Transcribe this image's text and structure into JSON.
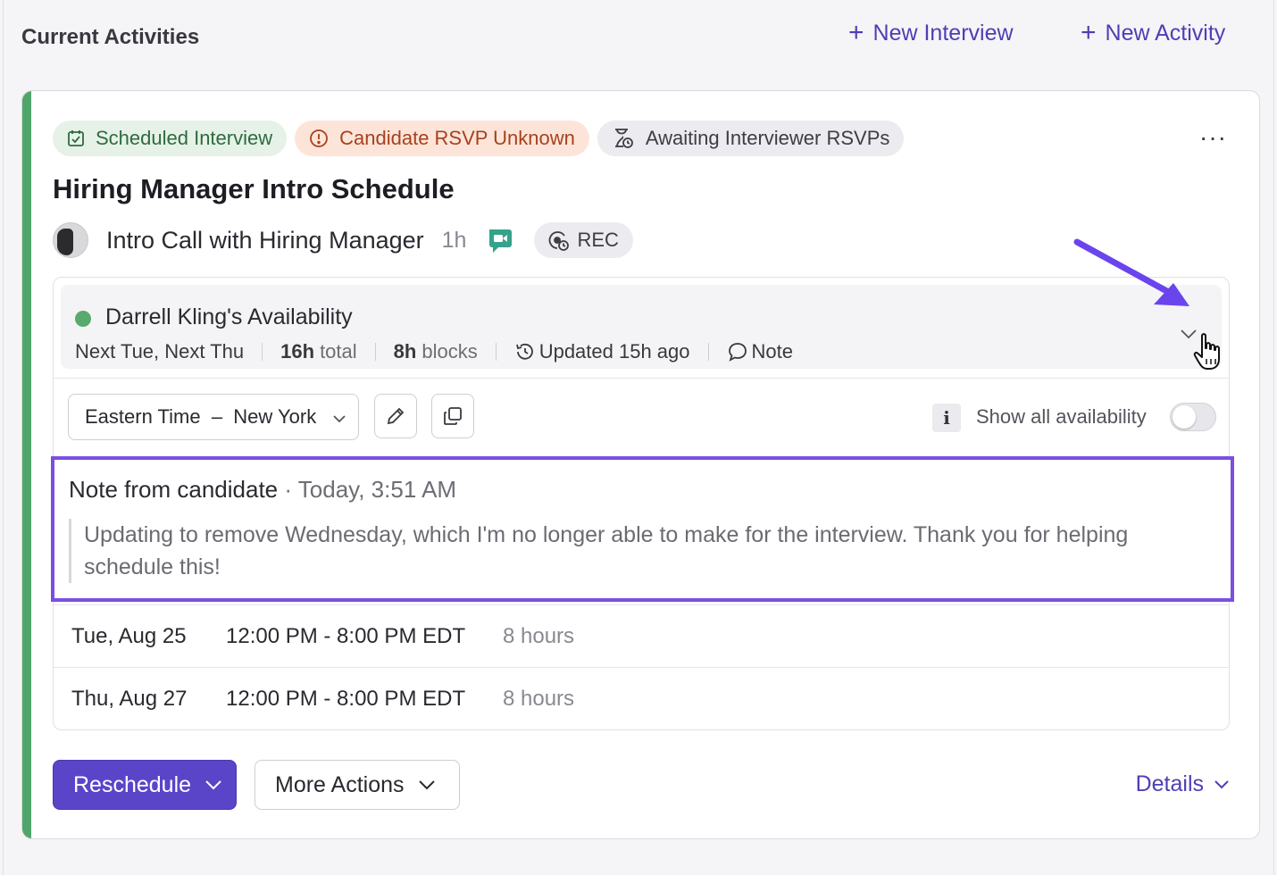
{
  "header": {
    "section_title": "Current Activities",
    "new_interview": "New Interview",
    "new_activity": "New Activity"
  },
  "card": {
    "tags": [
      {
        "label": "Scheduled Interview",
        "icon": "calendar-check-icon"
      },
      {
        "label": "Candidate RSVP Unknown",
        "icon": "alert-circle-icon"
      },
      {
        "label": "Awaiting Interviewer RSVPs",
        "icon": "hourglass-clock-icon"
      }
    ],
    "more_icon": "more-horizontal-icon",
    "title": "Hiring Manager Intro Schedule",
    "meeting": {
      "name": "Intro Call with Hiring Manager",
      "duration": "1h",
      "video_icon": "google-meet-icon",
      "rec_label": "REC"
    },
    "availability": {
      "name": "Darrell Kling's Availability",
      "days": "Next Tue, Next Thu",
      "total_value": "16h",
      "total_label": "total",
      "blocks_value": "8h",
      "blocks_label": "blocks",
      "updated": "Updated 15h ago",
      "note_label": "Note",
      "timezone": "Eastern Time  –  New York",
      "show_all_label": "Show all availability",
      "show_all_enabled": false,
      "info_icon_text": "i"
    },
    "note": {
      "label": "Note from candidate",
      "time": " · Today, 3:51 AM",
      "text": "Updating to remove Wednesday, which I'm no longer able to make for the interview. Thank you for helping schedule this!"
    },
    "slots": [
      {
        "date": "Tue, Aug 25",
        "time": "12:00 PM - 8:00 PM EDT",
        "hours": "8 hours"
      },
      {
        "date": "Thu, Aug 27",
        "time": "12:00 PM - 8:00 PM EDT",
        "hours": "8 hours"
      }
    ],
    "actions": {
      "reschedule": "Reschedule",
      "more_actions": "More Actions",
      "details": "Details"
    }
  },
  "colors": {
    "accent": "#5a45c9",
    "link": "#4d3fb4",
    "status_green": "#4fa56a",
    "highlight": "#7a4fe0"
  }
}
